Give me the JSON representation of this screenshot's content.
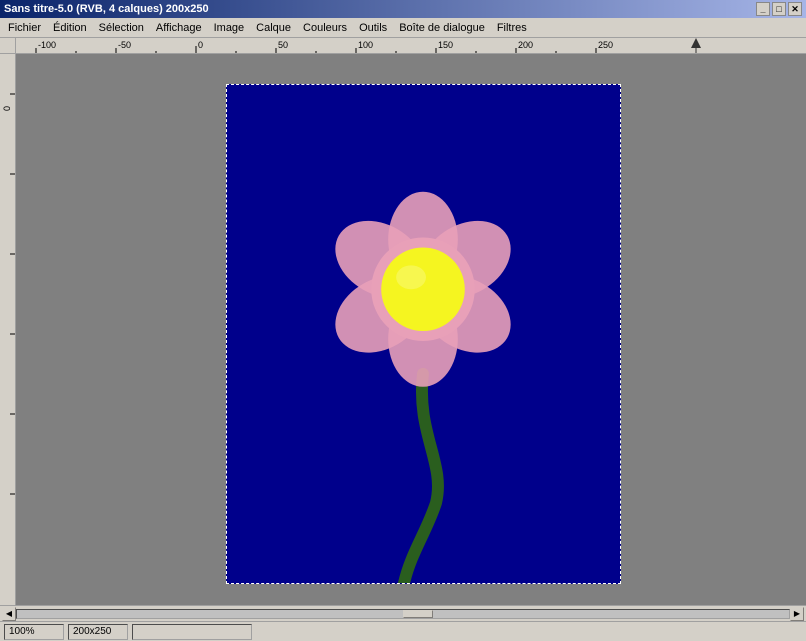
{
  "titlebar": {
    "title": "Sans titre-5.0 (RVB, 4 calques) 200x250",
    "minimize_label": "_",
    "maximize_label": "□",
    "close_label": "✕"
  },
  "menubar": {
    "items": [
      {
        "label": "Fichier"
      },
      {
        "label": "Édition"
      },
      {
        "label": "Sélection"
      },
      {
        "label": "Affichage"
      },
      {
        "label": "Image"
      },
      {
        "label": "Calque"
      },
      {
        "label": "Couleurs"
      },
      {
        "label": "Outils"
      },
      {
        "label": "Boîte de dialogue"
      },
      {
        "label": "Filtres"
      }
    ]
  },
  "ruler": {
    "h_labels": [
      "-100",
      "-50",
      "0",
      "50",
      "100",
      "150",
      "200",
      "250"
    ],
    "v_labels": []
  },
  "statusbar": {
    "zoom": "100%",
    "size": "200x250"
  },
  "colors": {
    "canvas_bg": "#00247a",
    "flower_petal": "#e8a0b8",
    "flower_center": "#f0f000",
    "flower_stem": "#2a5e1e",
    "ui_bg": "#d4d0c8",
    "title_gradient_start": "#0a246a",
    "title_gradient_end": "#a6b5e7"
  }
}
